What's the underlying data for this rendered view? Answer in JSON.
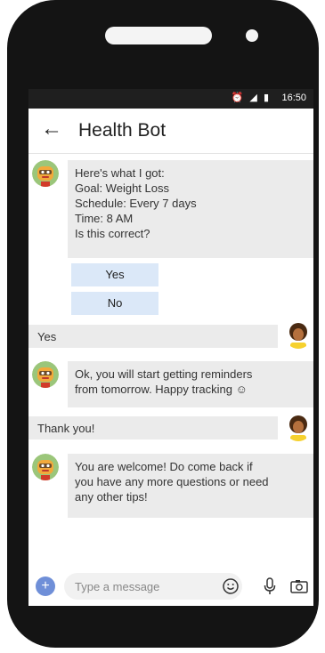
{
  "status_bar": {
    "time": "16:50",
    "icons": "⏰ ◢ ▮"
  },
  "header": {
    "title": "Health Bot",
    "back_icon": "back-arrow-icon"
  },
  "messages": {
    "bot_summary": {
      "lines": [
        "Here's what I got:",
        "Goal: Weight Loss",
        "Schedule: Every 7 days",
        "Time: 8 AM",
        "Is this correct?"
      ]
    },
    "quick_replies": [
      "Yes",
      "No"
    ],
    "user_yes": "Yes",
    "bot_reminders": {
      "lines": [
        "Ok, you will start getting reminders",
        "from tomorrow. Happy tracking ☺"
      ]
    },
    "user_thanks": "Thank you!",
    "bot_welcome": {
      "lines": [
        "You are welcome! Do come back if",
        "you have any more questions or need",
        "any other tips!"
      ]
    }
  },
  "composer": {
    "placeholder": "Type a message",
    "add_icon": "plus-icon",
    "emoji_icon": "smiley-icon",
    "mic_icon": "microphone-icon",
    "camera_icon": "camera-icon"
  },
  "colors": {
    "bubble": "#ebebeb",
    "quick_reply": "#dbe8f8",
    "accent": "#6f8fd8",
    "bot_avatar": "#f2a93b"
  }
}
